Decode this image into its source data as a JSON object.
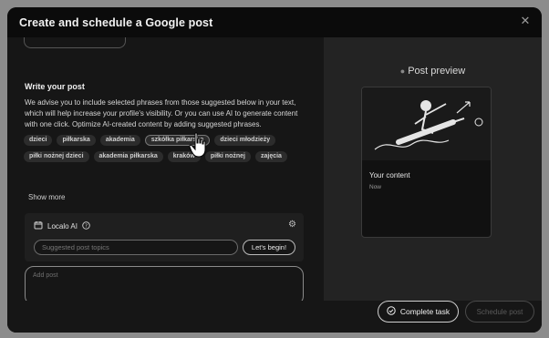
{
  "modal": {
    "title": "Create and schedule a Google post",
    "close_icon": "close-icon"
  },
  "compose": {
    "section_title": "Write your post",
    "advice": "We advise you to include selected phrases from those suggested below in your text, which will help increase your profile's visibility. Or you can use AI to generate content with one click. Optimize AI-created content by adding suggested phrases.",
    "phrase_rows": [
      [
        "dzieci",
        "piłkarska",
        "akademia",
        "szkółka piłkarska",
        "dzieci młodzieży"
      ],
      [
        "piłki nożnej dzieci",
        "akademia piłkarska",
        "kraków",
        "piłki nożnej",
        "zajęcia"
      ]
    ],
    "show_more": "Show more",
    "post_placeholder": "Add post"
  },
  "ai": {
    "label": "Localo AI",
    "topics_placeholder": "Suggested post topics",
    "begin_button": "Let's begin!"
  },
  "preview": {
    "title": "Post preview",
    "content_label": "Your content",
    "time_label": "Now"
  },
  "footer": {
    "complete_button": "Complete task",
    "schedule_button": "Schedule post"
  },
  "colors": {
    "modal_bg": "#141414",
    "header_bg": "#0b0b0b",
    "backdrop": "#8c8c8c"
  }
}
